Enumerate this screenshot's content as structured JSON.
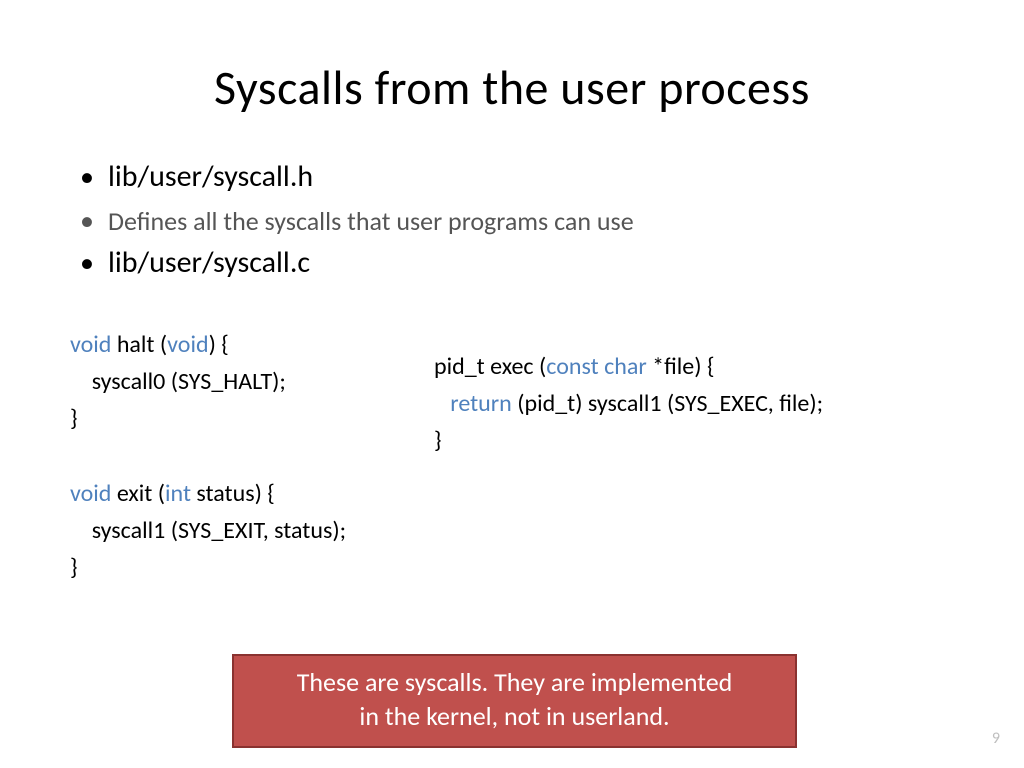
{
  "title": "Syscalls from the user process",
  "bullets": {
    "item0": "lib/user/syscall.h",
    "sub0": "Defines all the syscalls that user programs can use",
    "item1": "lib/user/syscall.c"
  },
  "code": {
    "halt_kw0": "void",
    "halt_name": " halt (",
    "halt_kw1": "void",
    "halt_close": ") {",
    "halt_body": "    syscall0 (SYS_HALT);",
    "halt_end": "}",
    "exit_kw0": "void",
    "exit_name": " exit (",
    "exit_kw1": "int",
    "exit_param": " status) {",
    "exit_body": "    syscall1 (SYS_EXIT, status);",
    "exit_end": "}",
    "exec_sig0": "pid_t exec (",
    "exec_kw0": "const char",
    "exec_sig1": " *file) {",
    "exec_kw1": "return",
    "exec_body": " (pid_t) syscall1 (SYS_EXEC, file);",
    "exec_end": "}"
  },
  "callout": {
    "line1": "These are syscalls. They are implemented",
    "line2": "in the kernel, not in userland."
  },
  "page_number": "9"
}
